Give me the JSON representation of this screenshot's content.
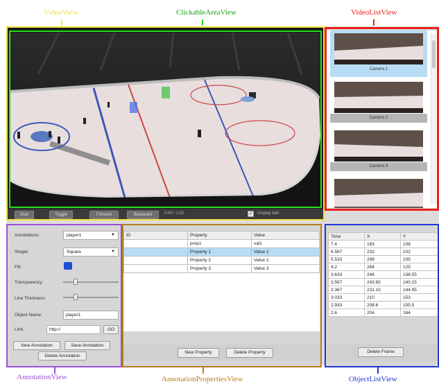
{
  "captions": {
    "video_view": "VideoView",
    "clickable_area_view": "ClickableAreaView",
    "video_list_view": "VideoListView",
    "annotation_view": "AnnotationView",
    "annotation_properties_view": "AnnotationPropertiesView",
    "object_list_view": "ObjectListView"
  },
  "colors": {
    "video_view": "#f2e23a",
    "clickable_area_view": "#22e01e",
    "video_list_view": "#e8211c",
    "annotation_view": "#9a4fd6",
    "annotation_properties_view": "#b87d1c",
    "object_list_view": "#2236d6",
    "selection": "#b8dcf5"
  },
  "controls": {
    "start": "Start",
    "toggle": "Toggle",
    "forward": "Forward",
    "backward": "Backward",
    "time": "0:00 / 1:52",
    "overlay_label": "Display ball",
    "overlay_checked": true
  },
  "video_list": {
    "items": [
      {
        "label": "Camera 1",
        "selected": true
      },
      {
        "label": "Camera 2",
        "selected": false
      },
      {
        "label": "Camera 3",
        "selected": false
      }
    ]
  },
  "annotation": {
    "annotations_label": "Annotations:",
    "annotations_value": "player1",
    "shape_label": "Shape:",
    "shape_value": "Square",
    "fill_label": "Fill:",
    "fill_color": "#1a4fd6",
    "transparency_label": "Transparency:",
    "transparency_level": 0.2,
    "line_thickness_label": "Line Thickness:",
    "line_thickness_level": 0.2,
    "object_name_label": "Object Name:",
    "object_name_value": "player1",
    "link_label": "Link:",
    "link_value": "http://",
    "go_button": "GO",
    "new_annotation": "New Annotation",
    "save_annotation": "Save Annotation",
    "delete_annotation": "Delete Annotation"
  },
  "properties": {
    "headers": [
      "ID",
      "Property",
      "Value"
    ],
    "rows": [
      {
        "id": "",
        "property": "prop1",
        "value": "val1"
      },
      {
        "id": "",
        "property": "Property 1",
        "value": "Value 1"
      },
      {
        "id": "",
        "property": "Property 2",
        "value": "Value 2"
      },
      {
        "id": "",
        "property": "Property 3",
        "value": "Value 3"
      }
    ],
    "selected_row": 1,
    "new_property": "New Property",
    "delete_property": "Delete Property"
  },
  "objects": {
    "headers": [
      "Time",
      "X",
      "Y"
    ],
    "rows": [
      [
        "7.4",
        "183",
        "108"
      ],
      [
        "6.567",
        "232",
        "102"
      ],
      [
        "5.533",
        "299",
        "105"
      ],
      [
        "4.2",
        "284",
        "125"
      ],
      [
        "3.633",
        "248",
        "138.55"
      ],
      [
        "3.567",
        "243.65",
        "140.15"
      ],
      [
        "3.367",
        "231.15",
        "144.95"
      ],
      [
        "3.033",
        "210",
        "153"
      ],
      [
        "2.933",
        "208.6",
        "155.5"
      ],
      [
        "2.6",
        "204",
        "164"
      ]
    ],
    "delete_frame": "Delete Frame"
  }
}
